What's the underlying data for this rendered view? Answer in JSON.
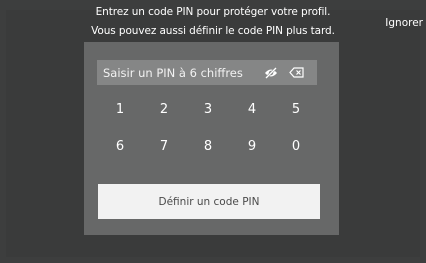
{
  "instructions": {
    "line1": "Entrez un code PIN pour protéger votre profil.",
    "line2": "Vous pouvez aussi définir le code PIN plus tard."
  },
  "skip_label": "Ignorer",
  "pin_input": {
    "placeholder": "Saisir un PIN à 6 chiffres",
    "toggle_visibility_icon": "eye-slash-icon",
    "backspace_icon": "backspace-icon"
  },
  "keypad": {
    "row1": [
      "1",
      "2",
      "3",
      "4",
      "5"
    ],
    "row2": [
      "6",
      "7",
      "8",
      "9",
      "0"
    ]
  },
  "set_pin_label": "Définir un code PIN",
  "colors": {
    "background": "#3d3e3e",
    "panel": "#676868",
    "input": "#858686",
    "button": "#f2f2f2"
  }
}
